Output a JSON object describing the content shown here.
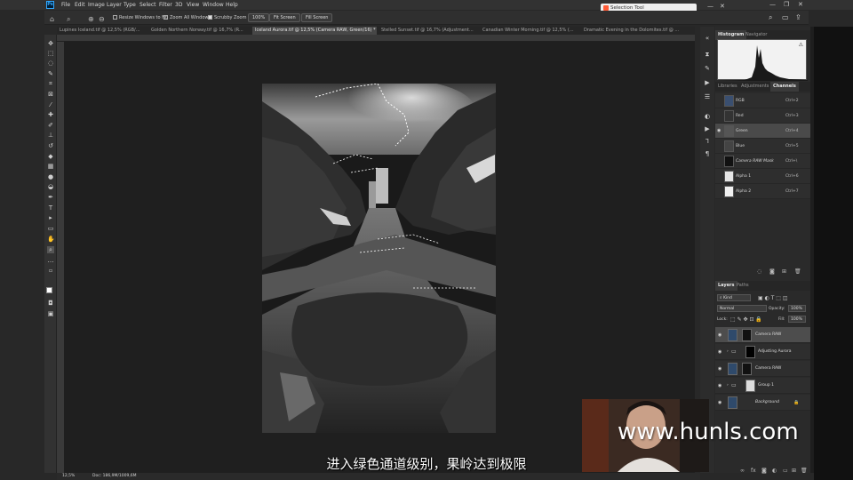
{
  "app": {
    "logo": "Ps",
    "menu": [
      "File",
      "Edit",
      "Image",
      "Layer",
      "Type",
      "Select",
      "Filter",
      "3D",
      "View",
      "Window",
      "Help"
    ],
    "window_controls": [
      "—",
      "❐",
      "✕"
    ],
    "selection_tool_tab": "Selection Tool"
  },
  "options_bar": {
    "resize_windows": "Resize Windows to Fit",
    "zoom_all": "Zoom All Windows",
    "scrubby_zoom": "Scrubby Zoom",
    "zoom_value": "100%",
    "fit_screen": "Fit Screen",
    "fill_screen": "Fill Screen"
  },
  "tabs": [
    {
      "label": "Lupines Iceland.tif @ 12,5% (RGB/..."
    },
    {
      "label": "Golden Northern Norway.tif @ 16,7% (R..."
    },
    {
      "label": "Iceland Aurora.tif @ 12,5% (Camera RAW, Green/16) *"
    },
    {
      "label": "Stelled Sunset.tif @ 16,7% (Adjustment..."
    },
    {
      "label": "Canadian Winter Morning.tif @ 12,5% (..."
    },
    {
      "label": "Dramatic Evening in the Dolomites.tif @ ..."
    }
  ],
  "panels": {
    "top_tabs": [
      "Histogram",
      "Navigator"
    ],
    "middle_tabs": [
      "Libraries",
      "Adjustments",
      "Channels"
    ],
    "channels": [
      {
        "name": "RGB",
        "shortcut": "Ctrl+2"
      },
      {
        "name": "Red",
        "shortcut": "Ctrl+3"
      },
      {
        "name": "Green",
        "shortcut": "Ctrl+4"
      },
      {
        "name": "Blue",
        "shortcut": "Ctrl+5"
      },
      {
        "name": "Camera RAW Mask",
        "shortcut": "Ctrl+\\"
      },
      {
        "name": "Alpha 1",
        "shortcut": "Ctrl+6"
      },
      {
        "name": "Alpha 2",
        "shortcut": "Ctrl+7"
      }
    ],
    "layers_tabs": [
      "Layers",
      "Paths"
    ],
    "kind_label": "Kind",
    "blend_mode": "Normal",
    "opacity_label": "Opacity:",
    "opacity_value": "100%",
    "lock_label": "Lock:",
    "fill_label": "Fill:",
    "fill_value": "100%",
    "layers": [
      {
        "name": "Camera RAW"
      },
      {
        "name": "Adjusting Aurora"
      },
      {
        "name": "Camera RAW"
      },
      {
        "name": "Group 1"
      },
      {
        "name": "Background"
      }
    ]
  },
  "status": {
    "zoom": "12,5%",
    "doc": "Doc: 186,9M/1009,6M"
  },
  "subtitle": "进入绿色通道级别，果岭达到极限",
  "watermark": "www.hunls.com"
}
